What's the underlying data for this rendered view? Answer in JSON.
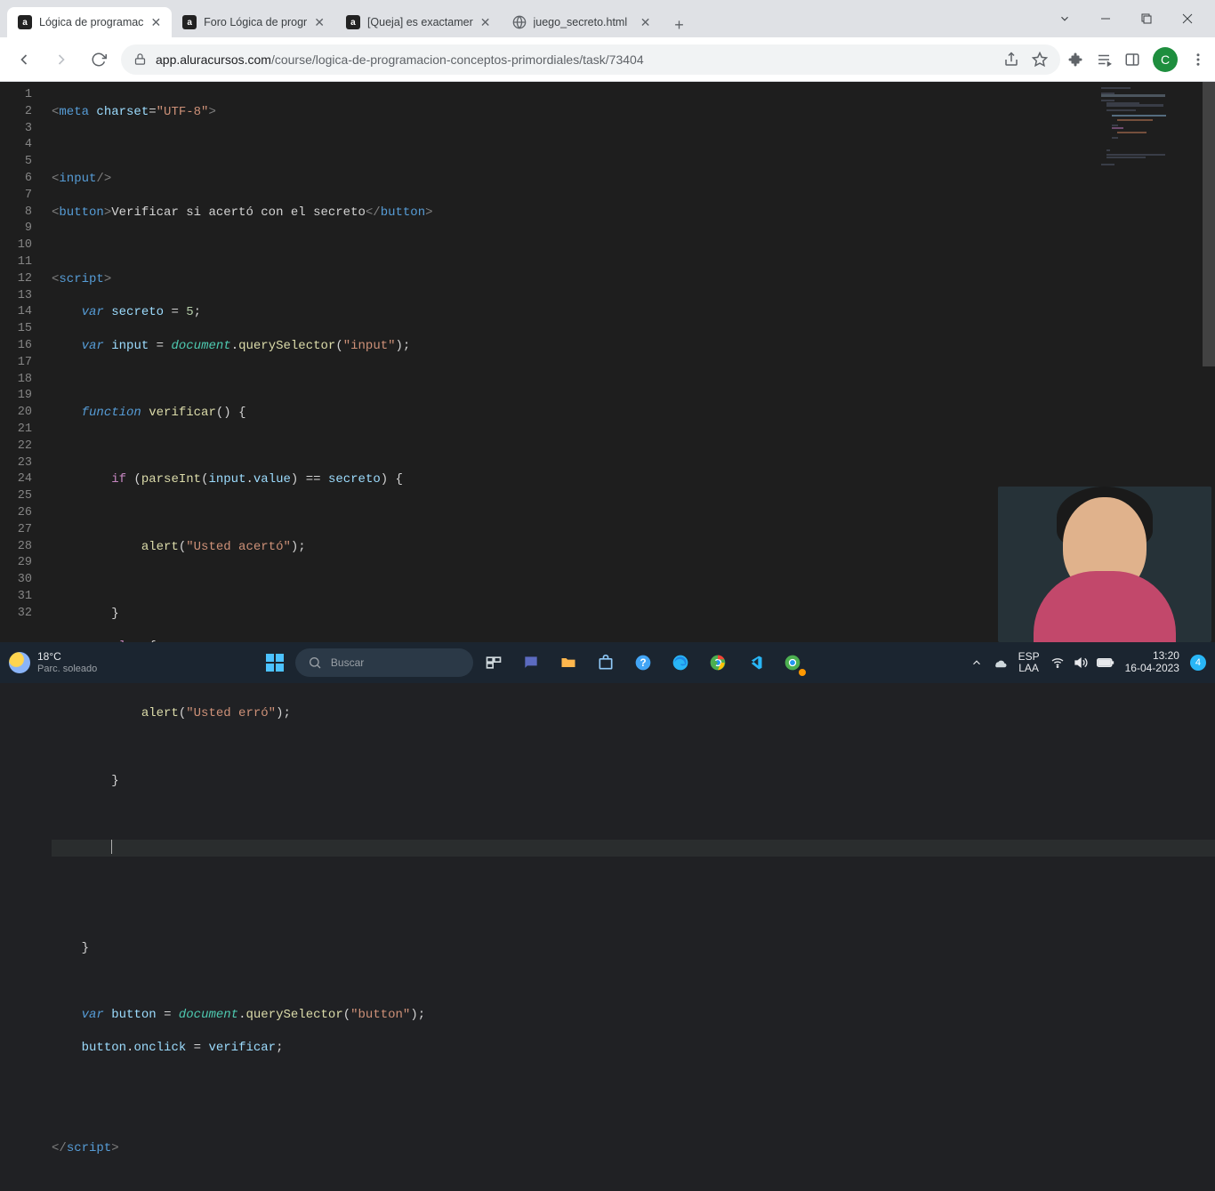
{
  "tabs": [
    {
      "title": "Lógica de programac",
      "favicon": "a"
    },
    {
      "title": "Foro Lógica de progr",
      "favicon": "a"
    },
    {
      "title": "[Queja] es exactamer",
      "favicon": "a"
    },
    {
      "title": "juego_secreto.html",
      "favicon": "globe"
    }
  ],
  "url": {
    "host": "app.aluracursos.com",
    "path": "/course/logica-de-programacion-conceptos-primordiales/task/73404"
  },
  "profile_letter": "C",
  "code_lines": 32,
  "search_placeholder": "Buscar",
  "weather": {
    "temp": "18°C",
    "desc": "Parc. soleado"
  },
  "lang": {
    "l1": "ESP",
    "l2": "LAA"
  },
  "clock": {
    "time": "13:20",
    "date": "16-04-2023"
  },
  "notif_count": "4",
  "code": {
    "l1": {
      "charset": "charset",
      "utf": "\"UTF-8\"",
      "meta": "meta"
    },
    "l3": {
      "input": "input"
    },
    "l4": {
      "button": "button",
      "text": "Verificar si acertó con el secreto"
    },
    "l6": {
      "script": "script"
    },
    "l7": {
      "var": "var",
      "secreto": "secreto",
      "five": "5"
    },
    "l8": {
      "var": "var",
      "input": "input",
      "document": "document",
      "qs": "querySelector",
      "arg": "\"input\""
    },
    "l10": {
      "function": "function",
      "name": "verificar"
    },
    "l12": {
      "if": "if",
      "parseInt": "parseInt",
      "input": "input",
      "value": "value",
      "secreto": "secreto"
    },
    "l14": {
      "alert": "alert",
      "msg": "\"Usted acertó\""
    },
    "l17": {
      "else": "else"
    },
    "l19": {
      "alert": "alert",
      "msg": "\"Usted erró\""
    },
    "l28": {
      "var": "var",
      "button": "button",
      "document": "document",
      "qs": "querySelector",
      "arg": "\"button\""
    },
    "l29": {
      "button": "button",
      "onclick": "onclick",
      "verificar": "verificar"
    },
    "l32": {
      "script": "script"
    }
  }
}
